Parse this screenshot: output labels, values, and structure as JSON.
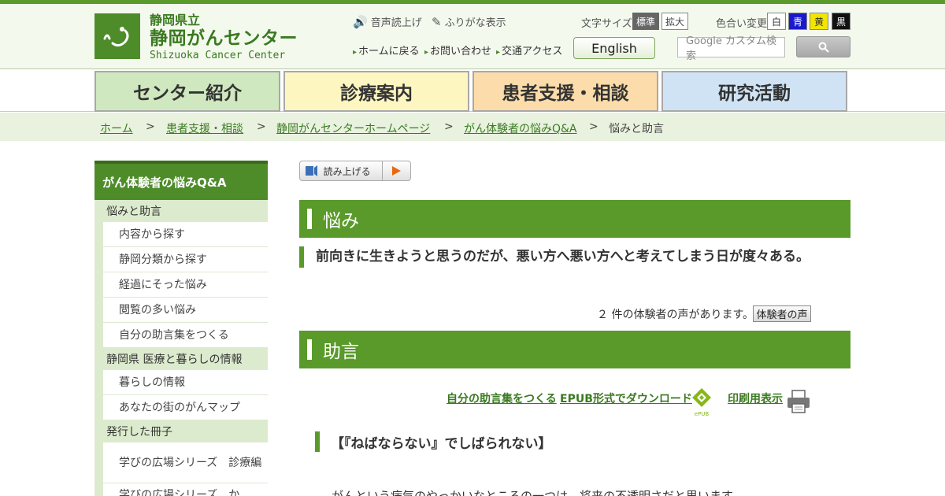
{
  "header": {
    "logo": {
      "line1": "静岡県立",
      "line2": "静岡がんセンター",
      "line3": "Shizuoka Cancer Center"
    },
    "utilities": {
      "voice_read": "音声読上げ",
      "furigana": "ふりがな表示"
    },
    "font_size": {
      "label": "文字サイズ",
      "standard": "標準",
      "large": "拡大"
    },
    "color_change": {
      "label": "色合い変更",
      "white": "白",
      "blue": "青",
      "yellow": "黄",
      "black": "黒"
    },
    "sub_links": {
      "home": "ホームに戻る",
      "contact": "お問い合わせ",
      "access": "交通アクセス"
    },
    "english": "English",
    "search": {
      "placeholder": "Google カスタム検索"
    },
    "colors": {
      "brand_green": "#4e8c2a",
      "blue_swatch": "#1a1acc",
      "yellow_swatch": "#f2e600",
      "black_swatch": "#111111"
    }
  },
  "nav": {
    "tabs": [
      {
        "label": "センター紹介",
        "color": "#cfe8bf"
      },
      {
        "label": "診療案内",
        "color": "#fdf6c0"
      },
      {
        "label": "患者支援・相談",
        "color": "#fbdcaa"
      },
      {
        "label": "研究活動",
        "color": "#cfe3f5"
      }
    ]
  },
  "breadcrumb": {
    "items": [
      "ホーム",
      "患者支援・相談",
      "静岡がんセンターホームページ",
      "がん体験者の悩みQ&A",
      "悩みと助言"
    ],
    "separator": ">"
  },
  "sidebar": {
    "title": "がん体験者の悩みQ&A",
    "sections": [
      {
        "label": "悩みと助言",
        "items": [
          "内容から探す",
          "静岡分類から探す",
          "経過にそった悩み",
          "閲覧の多い悩み",
          "自分の助言集をつくる"
        ]
      },
      {
        "label": "静岡県 医療と暮らしの情報",
        "items": [
          "暮らしの情報",
          "あなたの街のがんマップ"
        ]
      },
      {
        "label": "発行した冊子",
        "items": [
          "学びの広場シリーズ　診療編",
          "学びの広場シリーズ　か"
        ]
      }
    ]
  },
  "main": {
    "read_button": "読み上げる",
    "worry_heading": "悩み",
    "question": "前向きに生きようと思うのだが、悪い方へ悪い方へと考えてしまう日が度々ある。",
    "count_text": "２ 件の体験者の声があります。",
    "voice_button": "体験者の声",
    "advice_heading": "助言",
    "links": {
      "my_advice": "自分の助言集をつくる",
      "epub": "EPUB形式でダウンロード",
      "epub_badge": "ePUB",
      "print": "印刷用表示"
    },
    "sub_heading": "【『ねばならない』でしばられない】",
    "body_text": "がんという病気のやっかいなところの一つは、将来の不透明さだと思います。"
  }
}
